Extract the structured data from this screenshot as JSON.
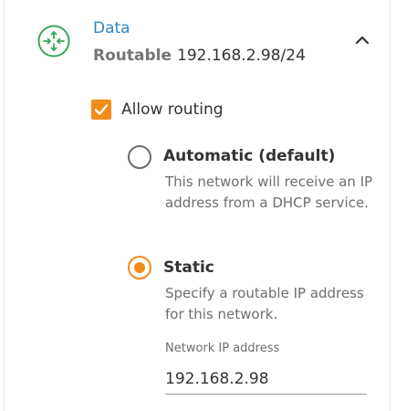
{
  "network": {
    "icon": "router-icon",
    "name": "Data",
    "mode": "Routable",
    "address": "192.168.2.98/24",
    "collapse_icon": "chevron-up-icon",
    "accent_color": "#2e86c1"
  },
  "routing": {
    "checkbox_label": "Allow routing",
    "checked": true,
    "check_color": "#f28c1a"
  },
  "options": [
    {
      "label": "Automatic (default)",
      "description": "This network will receive an IP address from a DHCP service.",
      "selected": false
    },
    {
      "label": "Static",
      "description": "Specify a routable IP address for this network.",
      "selected": true
    }
  ],
  "static_field": {
    "label": "Network IP address",
    "value": "192.168.2.98"
  }
}
